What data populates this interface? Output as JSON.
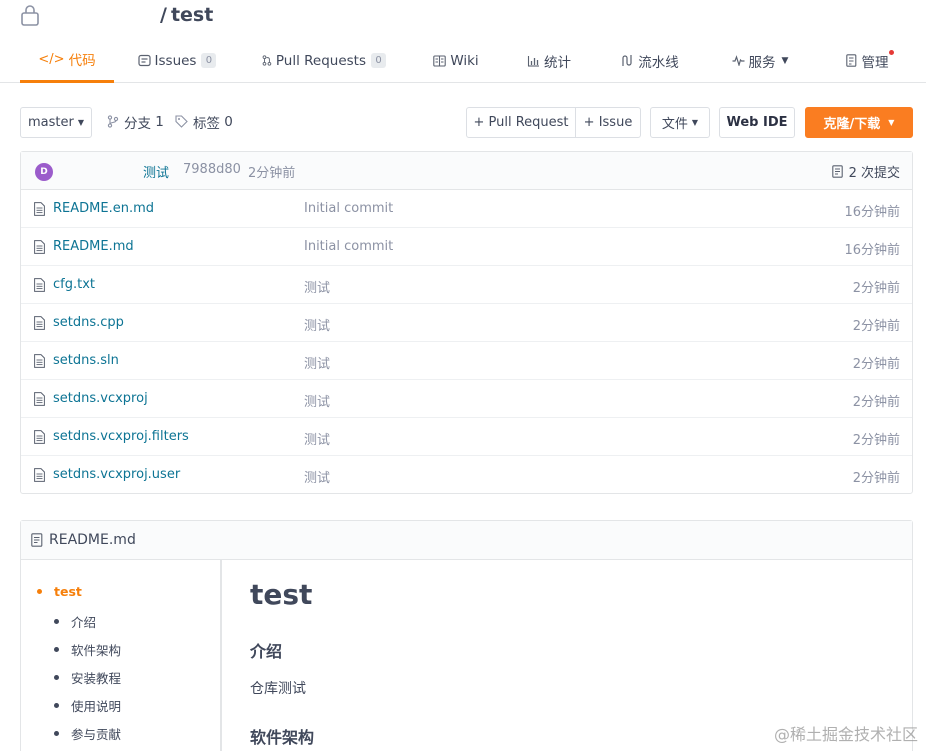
{
  "repo": {
    "separator": "/",
    "name": "test"
  },
  "tabs": [
    {
      "label": "代码",
      "icon": "code-icon"
    },
    {
      "label": "Issues",
      "badge": "0",
      "icon": "issues-icon"
    },
    {
      "label": "Pull Requests",
      "badge": "0",
      "icon": "pull-request-icon"
    },
    {
      "label": "Wiki",
      "icon": "wiki-icon"
    },
    {
      "label": "统计",
      "icon": "stats-icon"
    },
    {
      "label": "流水线",
      "icon": "pipeline-icon"
    },
    {
      "label": "服务",
      "icon": "service-icon"
    },
    {
      "label": "管理",
      "icon": "manage-icon"
    }
  ],
  "toolbar": {
    "branch": "master",
    "branches_label": "分支",
    "branches_count": "1",
    "tags_label": "标签",
    "tags_count": "0",
    "pull_request": "+ Pull Request",
    "issue": "+ Issue",
    "file": "文件",
    "web_ide": "Web IDE",
    "clone": "克隆/下载"
  },
  "latest_commit": {
    "avatar": "D",
    "message": "测试",
    "hash": "7988d80",
    "time": "2分钟前",
    "count": "2 次提交"
  },
  "files": [
    {
      "name": "README.en.md",
      "message": "Initial commit",
      "time": "16分钟前"
    },
    {
      "name": "README.md",
      "message": "Initial commit",
      "time": "16分钟前"
    },
    {
      "name": "cfg.txt",
      "message": "测试",
      "time": "2分钟前"
    },
    {
      "name": "setdns.cpp",
      "message": "测试",
      "time": "2分钟前"
    },
    {
      "name": "setdns.sln",
      "message": "测试",
      "time": "2分钟前"
    },
    {
      "name": "setdns.vcxproj",
      "message": "测试",
      "time": "2分钟前"
    },
    {
      "name": "setdns.vcxproj.filters",
      "message": "测试",
      "time": "2分钟前"
    },
    {
      "name": "setdns.vcxproj.user",
      "message": "测试",
      "time": "2分钟前"
    }
  ],
  "readme": {
    "filename": "README.md",
    "toc": [
      "test",
      "介绍",
      "软件架构",
      "安装教程",
      "使用说明",
      "参与贡献"
    ],
    "h1": "test",
    "h2_intro": "介绍",
    "intro_text": "仓库测试",
    "h2_arch": "软件架构"
  },
  "watermark": "@稀土掘金技术社区",
  "colors": {
    "accent": "#f67f0a",
    "link": "#0d7494",
    "muted": "#8c92a4",
    "clone_button": "#fa7d21"
  }
}
